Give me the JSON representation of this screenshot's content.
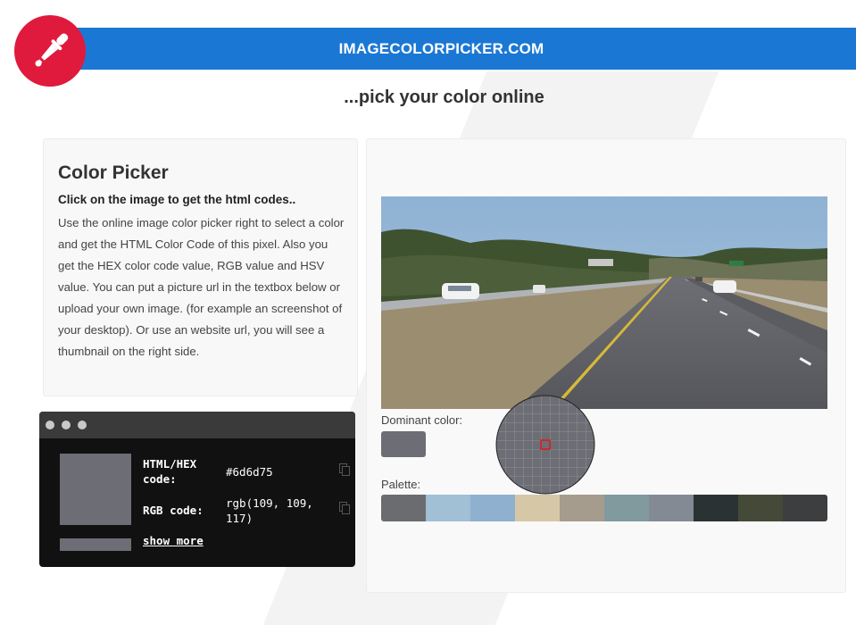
{
  "header": {
    "site_title": "IMAGECOLORPICKER.COM",
    "tagline": "...pick your color online",
    "logo_icon": "eyedropper-icon",
    "accent_color": "#1a78d4",
    "logo_color": "#e01a3c"
  },
  "info": {
    "title": "Color Picker",
    "lead": "Click on the image to get the html codes..",
    "description": "Use the online image color picker right to select a color and get the HTML Color Code of this pixel. Also you get the HEX color code value, RGB value and HSV value. You can put a picture url in the textbox below or upload your own image. (for example an screenshot of your desktop). Or use an website url, you will see a thumbnail on the right side."
  },
  "result": {
    "hex_label_line1": "HTML/HEX",
    "hex_label_line2": "code:",
    "hex_value": "#6d6d75",
    "rgb_label": "RGB code:",
    "rgb_value_line1": "rgb(109, 109,",
    "rgb_value_line2": "117)",
    "show_more": "show more",
    "swatch_color": "#6d6d75"
  },
  "image_panel": {
    "dominant_label": "Dominant color:",
    "dominant_color": "#6d6d75",
    "palette_label": "Palette:",
    "palette": [
      "#6b6c70",
      "#a1bfd5",
      "#8fb0cf",
      "#d6c8a7",
      "#a59c8e",
      "#809a9d",
      "#838a94",
      "#2b3234",
      "#454a38",
      "#3d3e3f"
    ]
  }
}
